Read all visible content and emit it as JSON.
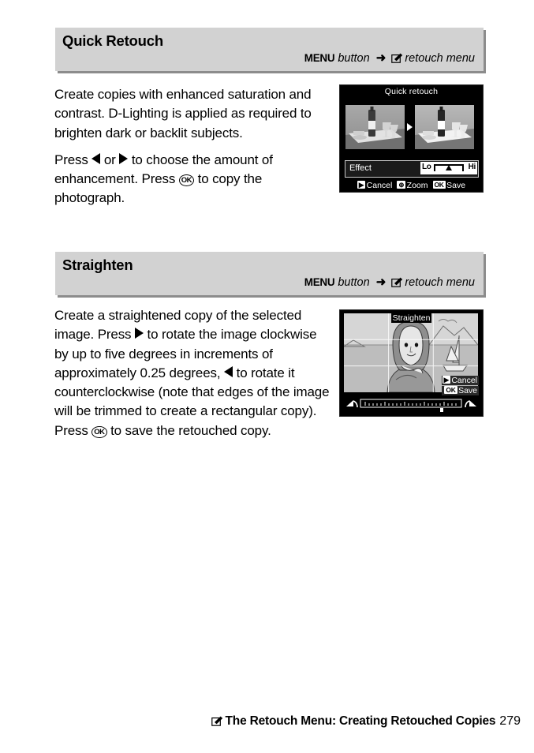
{
  "page": {
    "number": "279",
    "footer_title": "The Retouch Menu: Creating Retouched Copies",
    "footer_icon": "retouch-menu-icon"
  },
  "sections": [
    {
      "id": "quick-retouch",
      "title": "Quick Retouch",
      "route": {
        "menu_word": "MENU",
        "button_word": "button",
        "arrow": "➜",
        "icon": "retouch-menu-icon",
        "destination": "retouch menu"
      },
      "paragraphs": [
        {
          "parts": [
            {
              "type": "text",
              "value": "Create copies with enhanced saturation and contrast.  D-Lighting is applied as required to brighten dark or backlit subjects."
            }
          ]
        },
        {
          "parts": [
            {
              "type": "text",
              "value": "Press "
            },
            {
              "type": "icon",
              "value": "left-triangle-icon"
            },
            {
              "type": "text",
              "value": " or "
            },
            {
              "type": "icon",
              "value": "right-triangle-icon"
            },
            {
              "type": "text",
              "value": " to choose the amount of enhancement.  Press "
            },
            {
              "type": "icon",
              "value": "ok-button-icon",
              "label": "OK"
            },
            {
              "type": "text",
              "value": " to copy the photograph."
            }
          ]
        }
      ],
      "screenshot": {
        "type": "quick-retouch-lcd",
        "title": "Quick retouch",
        "before_thumb": "bottle-and-glasses-before",
        "after_thumb": "bottle-and-glasses-after",
        "effect_label": "Effect",
        "slider": {
          "low_label": "Lo",
          "high_label": "Hi",
          "position_percent": 50
        },
        "buttons": [
          {
            "key": "playback-key",
            "key_label": "▶",
            "label": "Cancel"
          },
          {
            "key": "zoom-key",
            "key_label": "⊕",
            "label": "Zoom"
          },
          {
            "key": "ok-key",
            "key_label": "OK",
            "label": "Save"
          }
        ]
      }
    },
    {
      "id": "straighten",
      "title": "Straighten",
      "route": {
        "menu_word": "MENU",
        "button_word": "button",
        "arrow": "➜",
        "icon": "retouch-menu-icon",
        "destination": "retouch menu"
      },
      "paragraphs": [
        {
          "parts": [
            {
              "type": "text",
              "value": "Create a straightened copy of the selected image.  Press "
            },
            {
              "type": "icon",
              "value": "right-triangle-icon"
            },
            {
              "type": "text",
              "value": " to rotate the image clockwise by up to five degrees in increments of approximately 0.25 degrees, "
            },
            {
              "type": "icon",
              "value": "left-triangle-icon"
            },
            {
              "type": "text",
              "value": " to rotate it counterclockwise (note that edges of the image will be trimmed to create a rectangular copy).  Press "
            },
            {
              "type": "icon",
              "value": "ok-button-icon",
              "label": "OK"
            },
            {
              "type": "text",
              "value": " to save the retouched copy."
            }
          ]
        }
      ],
      "screenshot": {
        "type": "straighten-lcd",
        "title": "Straighten",
        "scene": "woman-portrait-with-sailboat-and-horizon",
        "grid": "rule-of-thirds-grid",
        "buttons": [
          {
            "key": "playback-key",
            "key_label": "▶",
            "label": "Cancel"
          },
          {
            "key": "ok-key",
            "key_label": "OK",
            "label": "Save"
          }
        ],
        "ruler": {
          "left_icon": "rotate-counterclockwise-icon",
          "right_icon": "rotate-clockwise-icon",
          "pointer_percent": 78
        }
      }
    }
  ],
  "colors": {
    "header_bar": "#d2d2d2",
    "header_shadow": "#8c8c8c",
    "lcd_background": "#000000",
    "page_background": "#ffffff",
    "text": "#000000"
  }
}
